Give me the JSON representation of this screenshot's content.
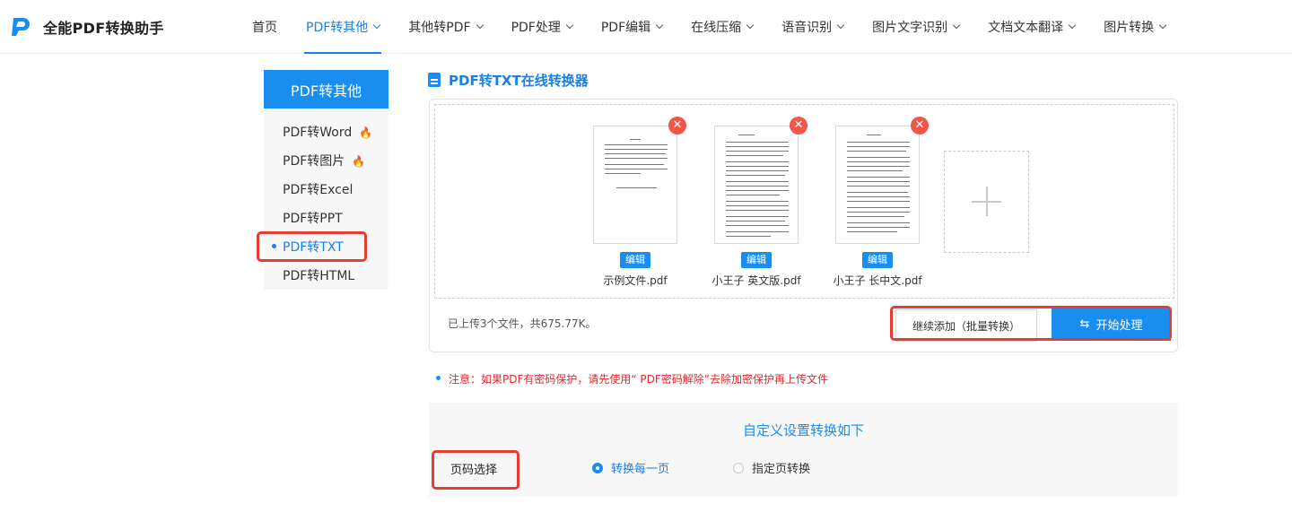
{
  "brand": {
    "name": "全能PDF转换助手",
    "logo_icon": "p-logo-icon"
  },
  "nav": [
    {
      "label": "首页",
      "dropdown": false,
      "active": false
    },
    {
      "label": "PDF转其他",
      "dropdown": true,
      "active": true
    },
    {
      "label": "其他转PDF",
      "dropdown": true,
      "active": false
    },
    {
      "label": "PDF处理",
      "dropdown": true,
      "active": false
    },
    {
      "label": "PDF编辑",
      "dropdown": true,
      "active": false
    },
    {
      "label": "在线压缩",
      "dropdown": true,
      "active": false
    },
    {
      "label": "语音识别",
      "dropdown": true,
      "active": false
    },
    {
      "label": "图片文字识别",
      "dropdown": true,
      "active": false
    },
    {
      "label": "文档文本翻译",
      "dropdown": true,
      "active": false
    },
    {
      "label": "图片转换",
      "dropdown": true,
      "active": false
    }
  ],
  "sidebar": {
    "heading": "PDF转其他",
    "items": [
      {
        "label": "PDF转Word",
        "hot": true
      },
      {
        "label": "PDF转图片",
        "hot": true
      },
      {
        "label": "PDF转Excel",
        "hot": false
      },
      {
        "label": "PDF转PPT",
        "hot": false
      },
      {
        "label": "PDF转TXT",
        "hot": false,
        "active": true
      },
      {
        "label": "PDF转HTML",
        "hot": false
      }
    ]
  },
  "main": {
    "title": "PDF转TXT在线转换器",
    "files": [
      {
        "name": "示例文件.pdf",
        "edit_label": "编辑"
      },
      {
        "name": "小王子 英文版.pdf",
        "edit_label": "编辑"
      },
      {
        "name": "小王子 长中文.pdf",
        "edit_label": "编辑"
      }
    ],
    "upload_info": "已上传3个文件，共675.77K。",
    "continue_label": "继续添加（批量转换）",
    "start_label": "开始处理",
    "notice": "注意：如果PDF有密码保护，请先使用“ PDF密码解除”去除加密保护再上传文件"
  },
  "settings": {
    "title": "自定义设置转换如下",
    "page_label": "页码选择",
    "options": [
      {
        "label": "转换每一页",
        "selected": true
      },
      {
        "label": "指定页转换",
        "selected": false
      }
    ]
  },
  "colors": {
    "accent": "#1a8ef0",
    "highlight": "#e53d2f",
    "warning": "#e5262c",
    "hot": "#ff7a30"
  }
}
